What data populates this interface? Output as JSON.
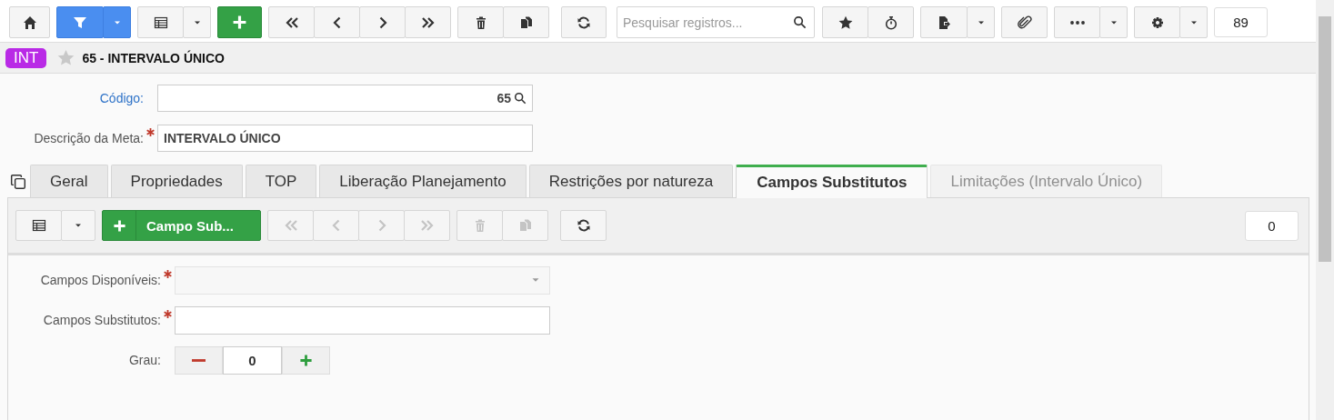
{
  "toolbar": {
    "filter_active": true,
    "search": {
      "placeholder": "Pesquisar registros..."
    },
    "record_count": "89"
  },
  "header": {
    "badge": "INT",
    "favorite": false,
    "title": "65 - INTERVALO ÚNICO"
  },
  "fields": [
    {
      "label": "Código:",
      "kind": "link",
      "required": false,
      "value": "65"
    },
    {
      "label": "Descrição da Meta:",
      "kind": "plain",
      "required": true,
      "value": "INTERVALO ÚNICO"
    }
  ],
  "tabs": [
    {
      "label": "Geral",
      "selected": false,
      "disabled": false
    },
    {
      "label": "Propriedades",
      "selected": false,
      "disabled": false
    },
    {
      "label": "TOP",
      "selected": false,
      "disabled": false
    },
    {
      "label": "Liberação Planejamento",
      "selected": false,
      "disabled": false
    },
    {
      "label": "Restrições por natureza",
      "selected": false,
      "disabled": false
    },
    {
      "label": "Campos Substitutos",
      "selected": true,
      "disabled": false
    },
    {
      "label": "Limitações (Intervalo Único)",
      "selected": false,
      "disabled": true
    }
  ],
  "sub_toolbar": {
    "add_label": "Campo Sub...",
    "navigation_disabled": true,
    "record_count": "0"
  },
  "form": [
    {
      "kind": "dropdown",
      "label": "Campos Disponíveis:",
      "required": true
    },
    {
      "kind": "text",
      "label": "Campos Substitutos:",
      "required": true
    },
    {
      "kind": "stepper",
      "label": "Grau:",
      "required": false,
      "value": "0"
    }
  ]
}
